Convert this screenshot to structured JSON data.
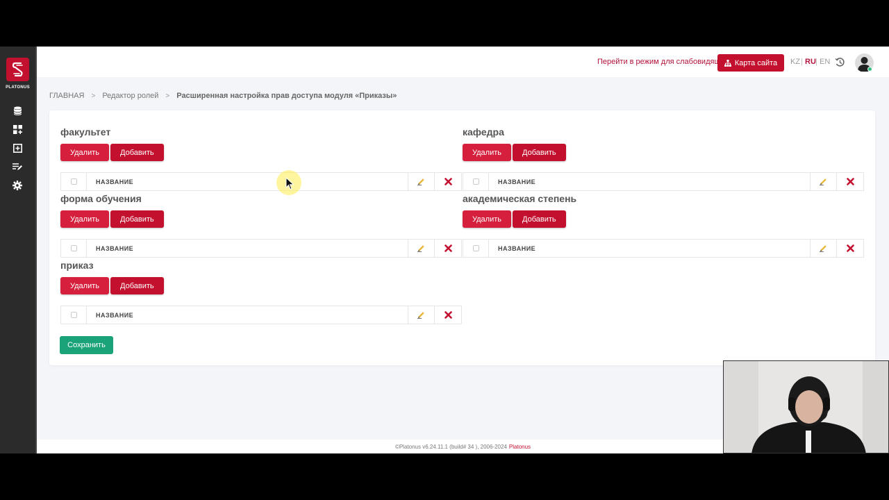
{
  "sidebar": {
    "logo_text": "PLATONUS",
    "items": [
      {
        "icon": "database-icon"
      },
      {
        "icon": "dashboard-icon"
      },
      {
        "icon": "add-box-icon"
      },
      {
        "icon": "edit-list-icon"
      },
      {
        "icon": "gear-icon"
      }
    ]
  },
  "topbar": {
    "low_vision_link": "Перейти в режим для слабовидящих",
    "sitemap_label": "Карта сайта",
    "languages": [
      "KZ",
      "RU",
      "EN"
    ],
    "active_language": "RU",
    "lang_separator": "|"
  },
  "breadcrumb": {
    "items": [
      "ГЛАВНАЯ",
      "Редактор ролей",
      "Расширенная настройка прав доступа модуля «Приказы»"
    ],
    "separator": ">"
  },
  "sections": [
    {
      "title": "факультет",
      "delete_label": "Удалить",
      "add_label": "Добавить",
      "column_header": "НАЗВАНИЕ"
    },
    {
      "title": "кафедра",
      "delete_label": "Удалить",
      "add_label": "Добавить",
      "column_header": "НАЗВАНИЕ"
    },
    {
      "title": "форма обучения",
      "delete_label": "Удалить",
      "add_label": "Добавить",
      "column_header": "НАЗВАНИЕ"
    },
    {
      "title": "академическая степень",
      "delete_label": "Удалить",
      "add_label": "Добавить",
      "column_header": "НАЗВАНИЕ"
    },
    {
      "title": "приказ",
      "delete_label": "Удалить",
      "add_label": "Добавить",
      "column_header": "НАЗВАНИЕ"
    }
  ],
  "save_label": "Сохранить",
  "footer": {
    "text": "©Platonus v6.24.11.1 (build# 34 ), 2006-2024",
    "brand": "Platonus"
  },
  "colors": {
    "brand_red": "#c4102f",
    "delete_red": "#d51f3d",
    "save_green": "#1aa378",
    "sidebar_bg": "#2b2b2b"
  }
}
